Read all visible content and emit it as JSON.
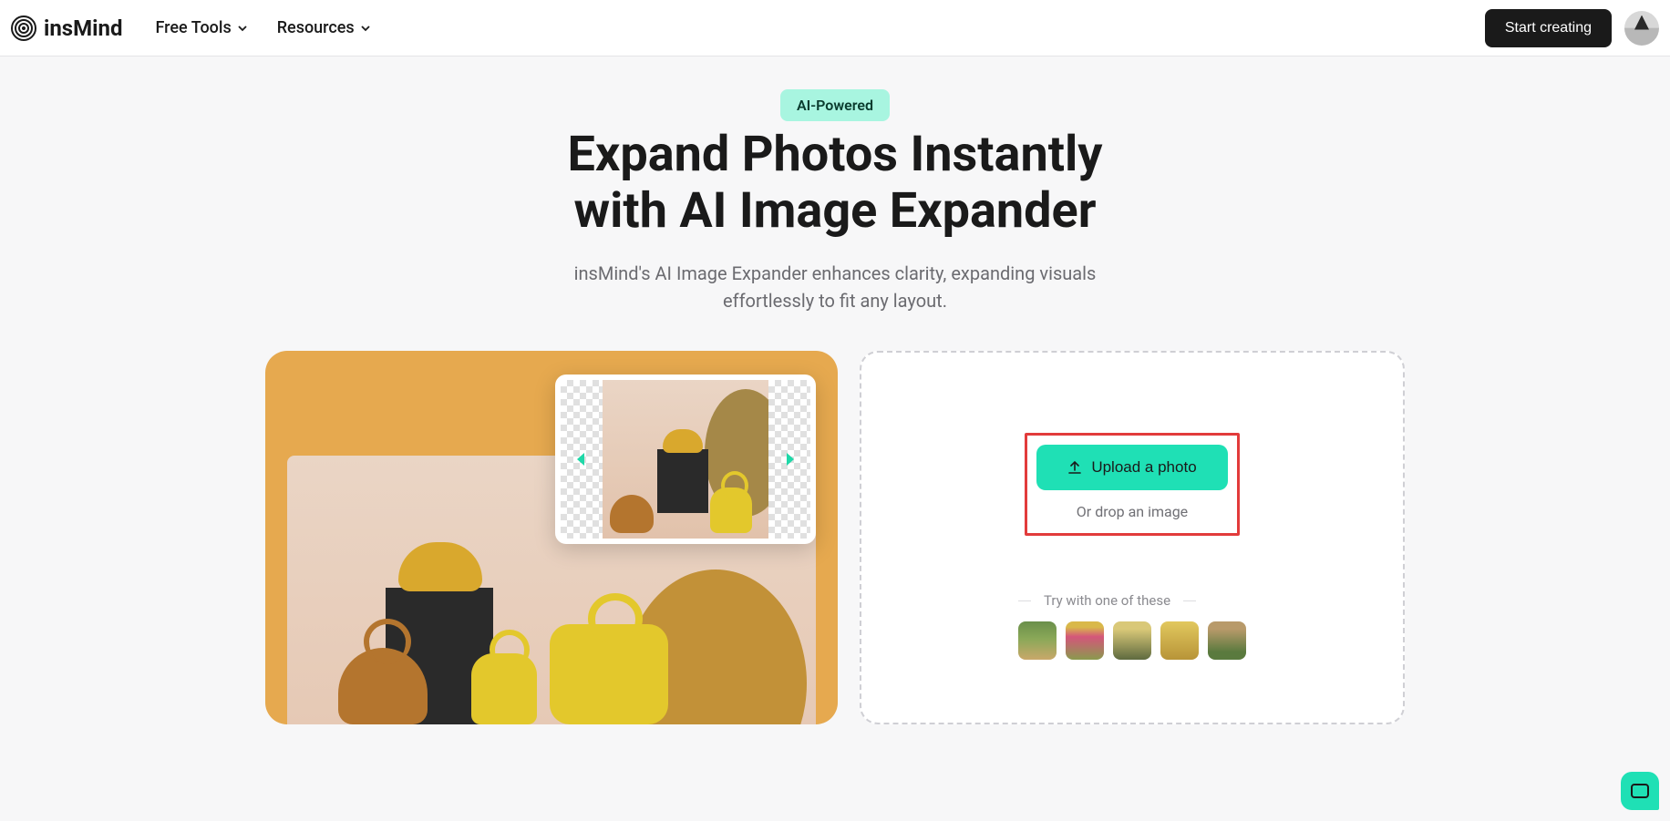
{
  "header": {
    "logo_text": "insMind",
    "nav": {
      "free_tools": "Free Tools",
      "resources": "Resources"
    },
    "cta": "Start creating"
  },
  "hero": {
    "badge": "AI-Powered",
    "title_line1": "Expand Photos Instantly",
    "title_line2": "with AI Image Expander",
    "subtitle_line1": "insMind's AI Image Expander enhances clarity, expanding visuals",
    "subtitle_line2": "effortlessly to fit any layout."
  },
  "upload": {
    "button_label": "Upload a photo",
    "drop_text": "Or drop an image",
    "try_label": "Try with one of these"
  }
}
